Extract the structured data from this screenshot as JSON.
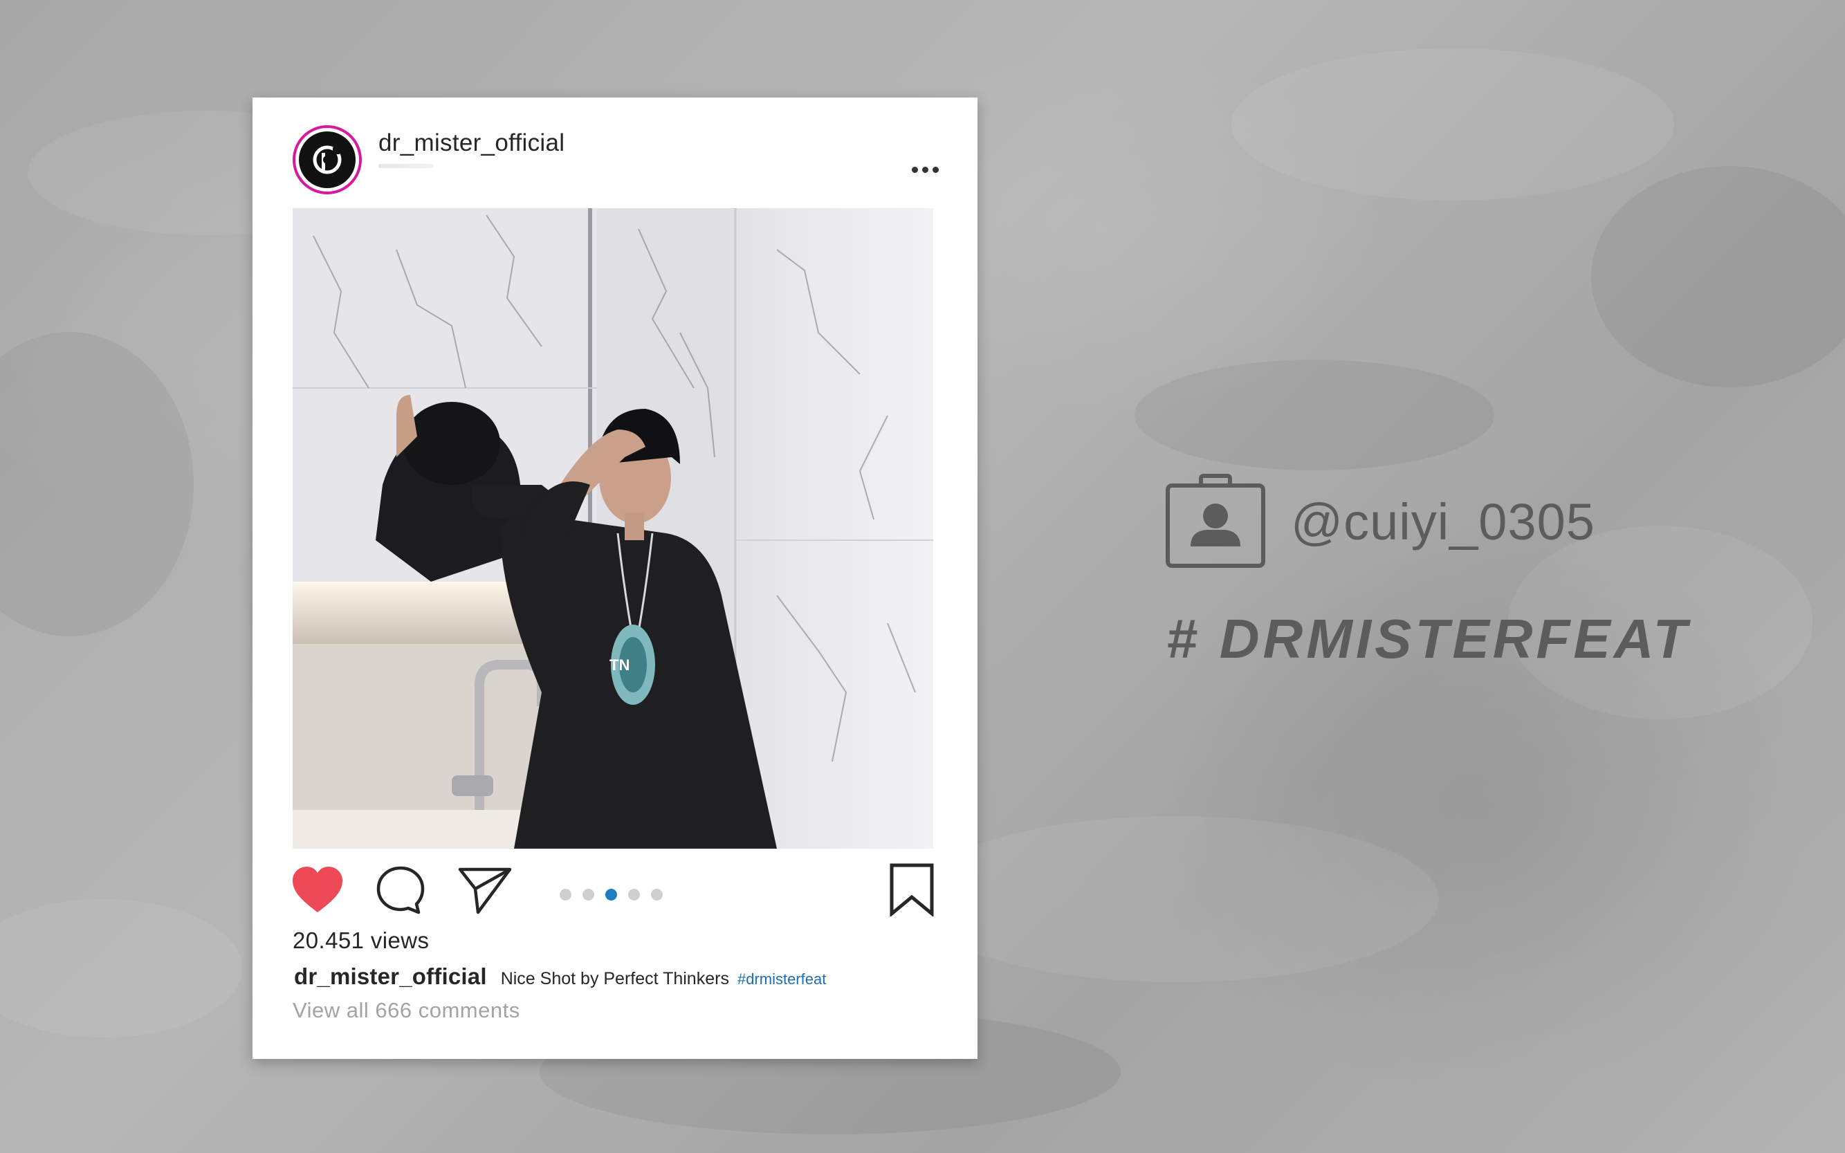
{
  "post": {
    "username": "dr_mister_official",
    "views": "20.451 views",
    "caption_user": "dr_mister_official",
    "caption_text": "Nice Shot by Perfect Thinkers",
    "caption_hashtag": "#drmisterfeat",
    "comments_link": "View all 666 comments",
    "carousel": {
      "count": 5,
      "active_index": 2
    },
    "liked": true
  },
  "side": {
    "handle": "@cuiyi_0305",
    "hashtag": "# DRMISTERFEAT"
  },
  "icons": {
    "avatar": "brand-logo-icon",
    "more": "more-options-icon",
    "like": "heart-icon",
    "comment": "comment-icon",
    "share": "send-icon",
    "save": "bookmark-icon",
    "profile": "profile-card-icon"
  },
  "colors": {
    "like_red": "#ed4956",
    "story_ring": "#d61a9e",
    "active_dot": "#1d7cc2",
    "hashtag_link": "#1d6fb0",
    "side_text": "#5c5c5c"
  }
}
